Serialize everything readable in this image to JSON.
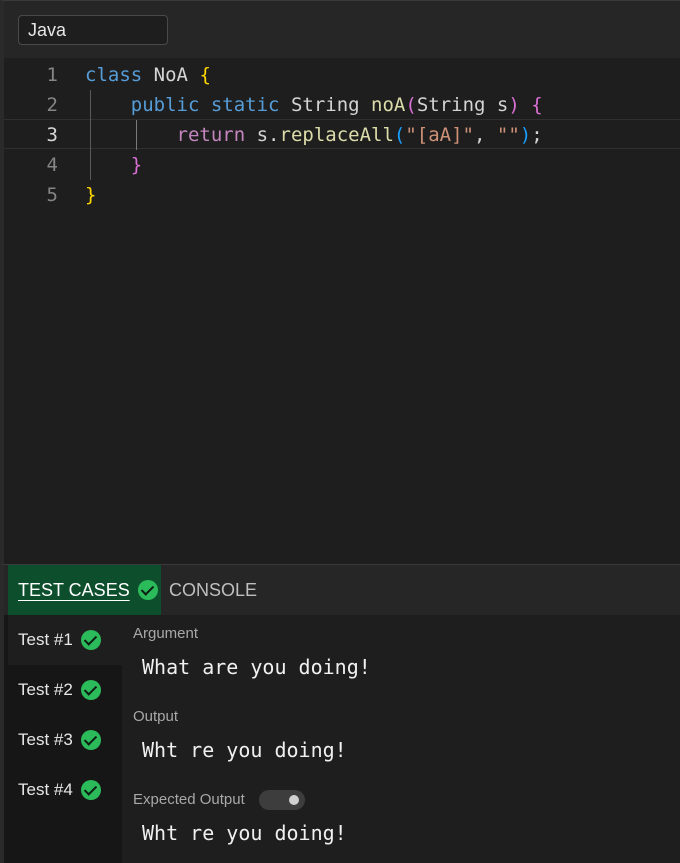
{
  "language_selector": {
    "value": "Java"
  },
  "editor": {
    "active_line": 3,
    "lines": [
      {
        "number": "1",
        "text": "class NoA {"
      },
      {
        "number": "2",
        "text": "    public static String noA(String s) {"
      },
      {
        "number": "3",
        "text": "        return s.replaceAll(\"[aA]\", \"\");"
      },
      {
        "number": "4",
        "text": "    }"
      },
      {
        "number": "5",
        "text": "}"
      }
    ]
  },
  "tabs": [
    {
      "label": "TEST CASES",
      "active": true,
      "status": "passed"
    },
    {
      "label": "CONSOLE",
      "active": false
    }
  ],
  "tests": [
    {
      "label": "Test #1",
      "status": "passed",
      "active": true
    },
    {
      "label": "Test #2",
      "status": "passed",
      "active": false
    },
    {
      "label": "Test #3",
      "status": "passed",
      "active": false
    },
    {
      "label": "Test #4",
      "status": "passed",
      "active": false
    }
  ],
  "details": {
    "argument_label": "Argument",
    "argument_value": "What are you doing!",
    "output_label": "Output",
    "output_value": "Wht re you doing!",
    "expected_label": "Expected Output",
    "expected_toggle_on": false,
    "expected_value": "Wht re you doing!"
  },
  "colors": {
    "accent_tab": "#0d4f2c",
    "pass": "#2bbb5a"
  },
  "icons": {
    "pass": "check-circle-icon"
  }
}
